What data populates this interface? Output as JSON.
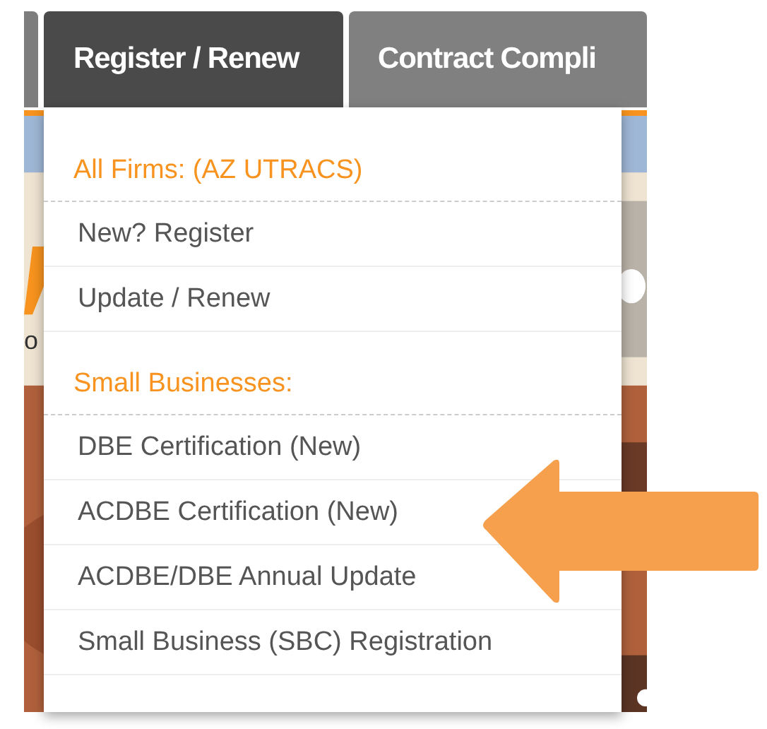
{
  "tabs": [
    {
      "label": "Register / Renew",
      "selected": true
    },
    {
      "label": "Contract Compli",
      "selected": false
    }
  ],
  "background_text": [
    "o"
  ],
  "menu": {
    "entries": [
      {
        "kind": "header",
        "label": "All Firms: (AZ UTRACS)"
      },
      {
        "kind": "item",
        "label": "New? Register"
      },
      {
        "kind": "item",
        "label": "Update / Renew"
      },
      {
        "kind": "header",
        "label": "Small Businesses:"
      },
      {
        "kind": "item",
        "label": "DBE Certification (New)"
      },
      {
        "kind": "item",
        "label": "ACDBE Certification (New)"
      },
      {
        "kind": "item",
        "label": "ACDBE/DBE Annual Update"
      },
      {
        "kind": "item",
        "label": "Small Business (SBC) Registration"
      }
    ]
  }
}
